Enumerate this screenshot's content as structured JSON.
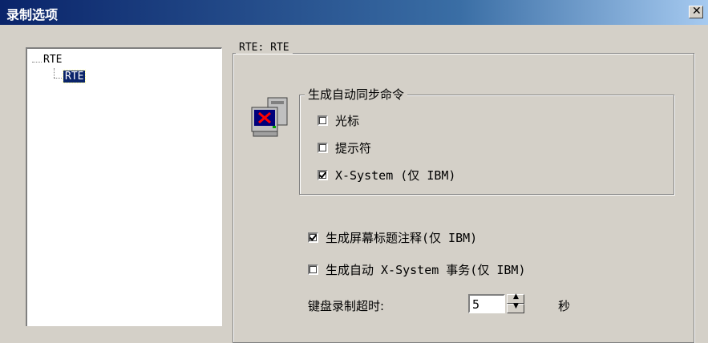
{
  "window": {
    "title": "录制选项",
    "close_symbol": "✕"
  },
  "tree": {
    "root": "RTE",
    "child": "RTE"
  },
  "group_rte": {
    "legend": "RTE: RTE"
  },
  "sync_group": {
    "legend": "生成自动同步命令",
    "options": [
      {
        "label": "光标",
        "checked": false
      },
      {
        "label": "提示符",
        "checked": false
      },
      {
        "label": "X-System (仅 IBM)",
        "checked": true
      }
    ]
  },
  "options": [
    {
      "label": "生成屏幕标题注释(仅 IBM)",
      "checked": true
    },
    {
      "label": "生成自动 X-System 事务(仅 IBM)",
      "checked": false
    }
  ],
  "timeout": {
    "label": "键盘录制超时:",
    "value": "5",
    "unit": "秒"
  },
  "icons": {
    "spin_up": "▲",
    "spin_down": "▼",
    "monitor": "terminal-x-icon"
  },
  "colors": {
    "titlebar_start": "#0a246a",
    "titlebar_end": "#a6caf0",
    "selection": "#0a246a",
    "dialog_bg": "#d4d0c8"
  }
}
